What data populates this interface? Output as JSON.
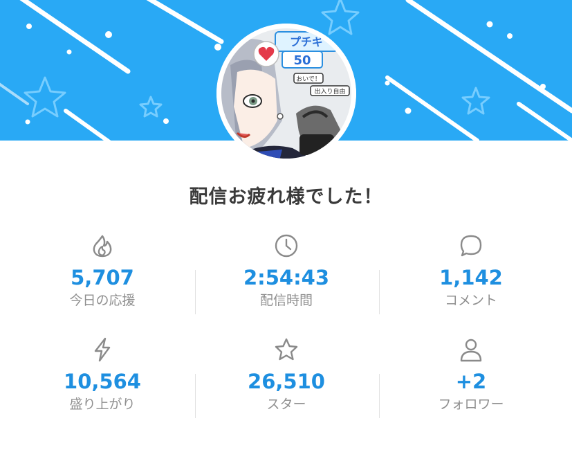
{
  "header": {
    "banner_color": "#29a9f5",
    "avatar_alt_text": {
      "badge_line1": "プチギ",
      "badge_count": "50",
      "sign1": "おいで！",
      "sign2": "出入り自由"
    }
  },
  "main": {
    "title": "配信お疲れ様でした！",
    "accent_color": "#1e8fe0",
    "stats": [
      {
        "icon": "flame-icon",
        "value": "5,707",
        "label": "今日の応援"
      },
      {
        "icon": "clock-icon",
        "value": "2:54:43",
        "label": "配信時間"
      },
      {
        "icon": "comment-icon",
        "value": "1,142",
        "label": "コメント"
      },
      {
        "icon": "lightning-icon",
        "value": "10,564",
        "label": "盛り上がり"
      },
      {
        "icon": "star-icon",
        "value": "26,510",
        "label": "スター"
      },
      {
        "icon": "person-icon",
        "value": "+2",
        "label": "フォロワー"
      }
    ]
  }
}
